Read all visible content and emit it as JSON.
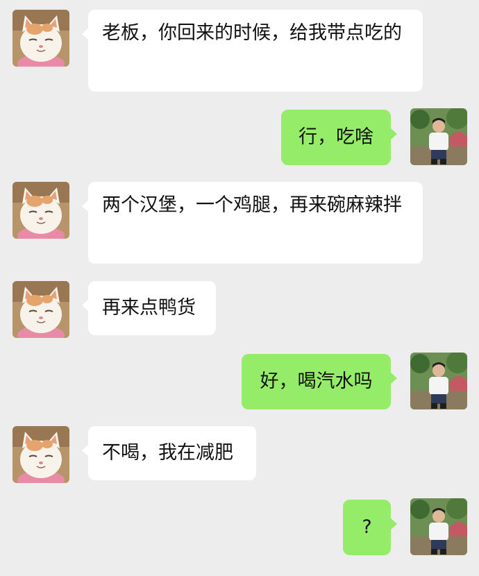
{
  "messages": [
    {
      "side": "in",
      "avatar": "cat-avatar",
      "text": "老板，你回来的时候，给我带点吃的"
    },
    {
      "side": "out",
      "avatar": "man-avatar",
      "text": "行，吃啥"
    },
    {
      "side": "in",
      "avatar": "cat-avatar",
      "text": "两个汉堡，一个鸡腿，再来碗麻辣拌"
    },
    {
      "side": "in",
      "avatar": "cat-avatar",
      "text": "再来点鸭货"
    },
    {
      "side": "out",
      "avatar": "man-avatar",
      "text": "好，喝汽水吗"
    },
    {
      "side": "in",
      "avatar": "cat-avatar",
      "text": "不喝，我在减肥"
    },
    {
      "side": "out",
      "avatar": "man-avatar",
      "text": "?"
    }
  ],
  "colors": {
    "background": "#ededed",
    "incoming_bubble": "#ffffff",
    "outgoing_bubble": "#95ec69"
  }
}
